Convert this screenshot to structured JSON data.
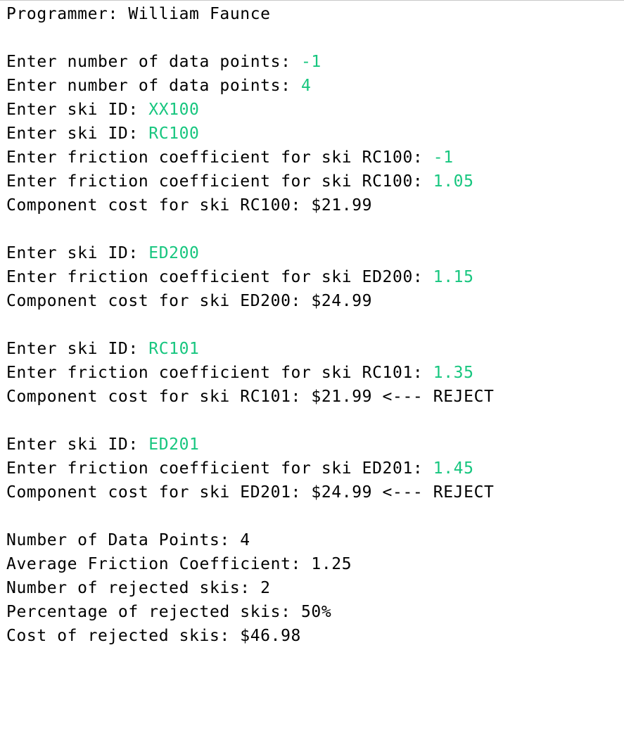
{
  "colors": {
    "output_text": "#000000",
    "user_input": "#17c67f",
    "background": "#ffffff"
  },
  "lines": [
    {
      "prompt": "Programmer: William Faunce",
      "input": ""
    },
    {
      "prompt": "",
      "input": ""
    },
    {
      "prompt": "Enter number of data points: ",
      "input": "-1"
    },
    {
      "prompt": "Enter number of data points: ",
      "input": "4"
    },
    {
      "prompt": "Enter ski ID: ",
      "input": "XX100"
    },
    {
      "prompt": "Enter ski ID: ",
      "input": "RC100"
    },
    {
      "prompt": "Enter friction coefficient for ski RC100: ",
      "input": "-1"
    },
    {
      "prompt": "Enter friction coefficient for ski RC100: ",
      "input": "1.05"
    },
    {
      "prompt": "Component cost for ski RC100: $21.99",
      "input": ""
    },
    {
      "prompt": "",
      "input": ""
    },
    {
      "prompt": "Enter ski ID: ",
      "input": "ED200"
    },
    {
      "prompt": "Enter friction coefficient for ski ED200: ",
      "input": "1.15"
    },
    {
      "prompt": "Component cost for ski ED200: $24.99",
      "input": ""
    },
    {
      "prompt": "",
      "input": ""
    },
    {
      "prompt": "Enter ski ID: ",
      "input": "RC101"
    },
    {
      "prompt": "Enter friction coefficient for ski RC101: ",
      "input": "1.35"
    },
    {
      "prompt": "Component cost for ski RC101: $21.99 <--- REJECT",
      "input": ""
    },
    {
      "prompt": "",
      "input": ""
    },
    {
      "prompt": "Enter ski ID: ",
      "input": "ED201"
    },
    {
      "prompt": "Enter friction coefficient for ski ED201: ",
      "input": "1.45"
    },
    {
      "prompt": "Component cost for ski ED201: $24.99 <--- REJECT",
      "input": ""
    },
    {
      "prompt": "",
      "input": ""
    },
    {
      "prompt": "Number of Data Points: 4",
      "input": ""
    },
    {
      "prompt": "Average Friction Coefficient: 1.25",
      "input": ""
    },
    {
      "prompt": "Number of rejected skis: 2",
      "input": ""
    },
    {
      "prompt": "Percentage of rejected skis: 50%",
      "input": ""
    },
    {
      "prompt": "Cost of rejected skis: $46.98",
      "input": ""
    }
  ]
}
